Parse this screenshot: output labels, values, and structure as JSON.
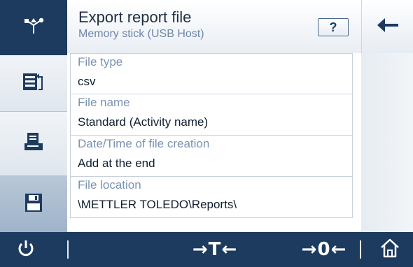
{
  "header": {
    "title": "Export report file",
    "subtitle": "Memory stick (USB Host)",
    "help_label": "?"
  },
  "settings": [
    {
      "label": "File type",
      "value": "csv"
    },
    {
      "label": "File name",
      "value": "Standard (Activity name)"
    },
    {
      "label": "Date/Time of file creation",
      "value": "Add at the end"
    },
    {
      "label": "File location",
      "value": "\\METTLER TOLEDO\\Reports\\"
    }
  ],
  "sidebar": {
    "items": [
      {
        "icon": "usb-icon",
        "active": true
      },
      {
        "icon": "export-file-icon",
        "active": false
      },
      {
        "icon": "printer-icon",
        "active": false
      },
      {
        "icon": "save-disk-icon",
        "active": false
      }
    ]
  },
  "bottombar": {
    "tare_label": "→T←",
    "zero_label": "→0←",
    "icons": [
      "power-icon",
      "home-icon"
    ]
  },
  "colors": {
    "primary": "#1c3b5f",
    "label": "#7a93b3",
    "accent_arrow": "#1c3b5f"
  }
}
